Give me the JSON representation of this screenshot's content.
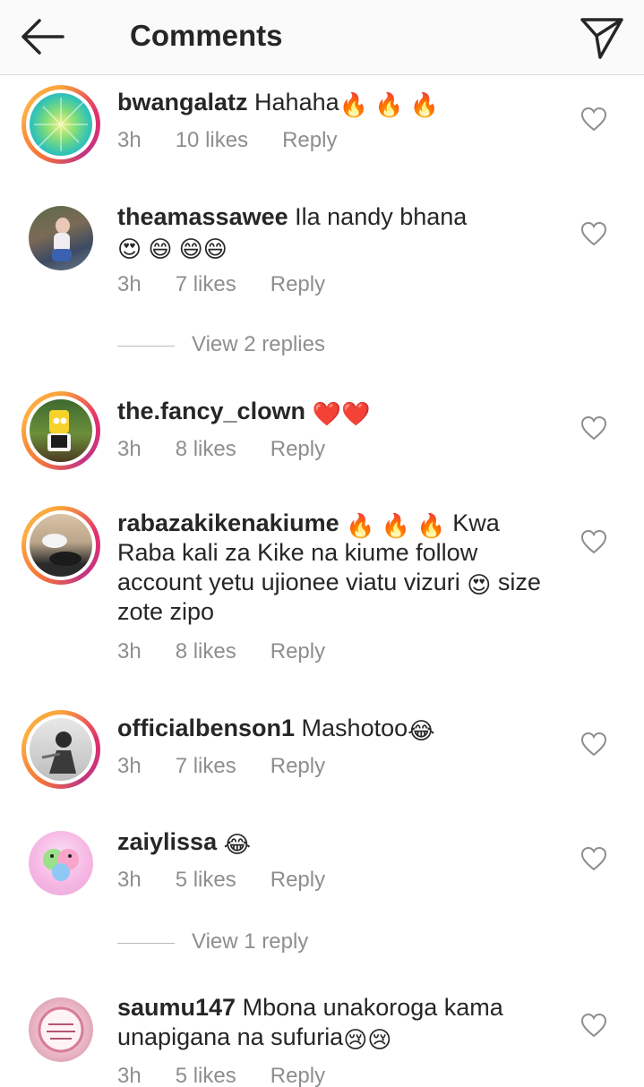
{
  "header": {
    "title": "Comments",
    "back_icon": "back-arrow-icon",
    "send_icon": "paper-plane-icon"
  },
  "comments": [
    {
      "username": "bwangalatz",
      "text": "Hahaha",
      "emoji_after": "🔥 🔥 🔥",
      "time": "3h",
      "likes": "10 likes",
      "reply": "Reply",
      "story_ring": true
    },
    {
      "username": "theamassawee",
      "text": "Ila nandy bhana",
      "emoji_after": "😍 😄 😄😄",
      "time": "3h",
      "likes": "7 likes",
      "reply": "Reply",
      "story_ring": false
    },
    {
      "username": "the.fancy_clown",
      "text": "",
      "emoji_after": "❤️❤️",
      "time": "3h",
      "likes": "8 likes",
      "reply": "Reply",
      "story_ring": true
    },
    {
      "username": "rabazakikenakiume",
      "text_before": "🔥 🔥 🔥",
      "text": "Kwa Raba kali za Kike na kiume follow account yetu ujionee viatu vizuri",
      "text_emoji": "😍",
      "text_after": "size zote zipo",
      "time": "3h",
      "likes": "8 likes",
      "reply": "Reply",
      "story_ring": true
    },
    {
      "username": "officialbenson1",
      "text": "Mashotoo",
      "emoji_after": "😂",
      "time": "3h",
      "likes": "7 likes",
      "reply": "Reply",
      "story_ring": true
    },
    {
      "username": "zaiylissa",
      "text": "",
      "emoji_after": "😂",
      "time": "3h",
      "likes": "5 likes",
      "reply": "Reply",
      "story_ring": false
    },
    {
      "username": "saumu147",
      "text": "Mbona unakoroga kama unapigana na sufuria",
      "emoji_after": "😢😢",
      "time": "3h",
      "likes": "5 likes",
      "reply": "Reply",
      "story_ring": false
    }
  ],
  "view_replies": [
    {
      "label": "View 2 replies"
    },
    {
      "label": "View 1 reply"
    }
  ],
  "colors": {
    "text": "#262626",
    "muted": "#8e8e8e",
    "topbar": "#fafafa"
  }
}
